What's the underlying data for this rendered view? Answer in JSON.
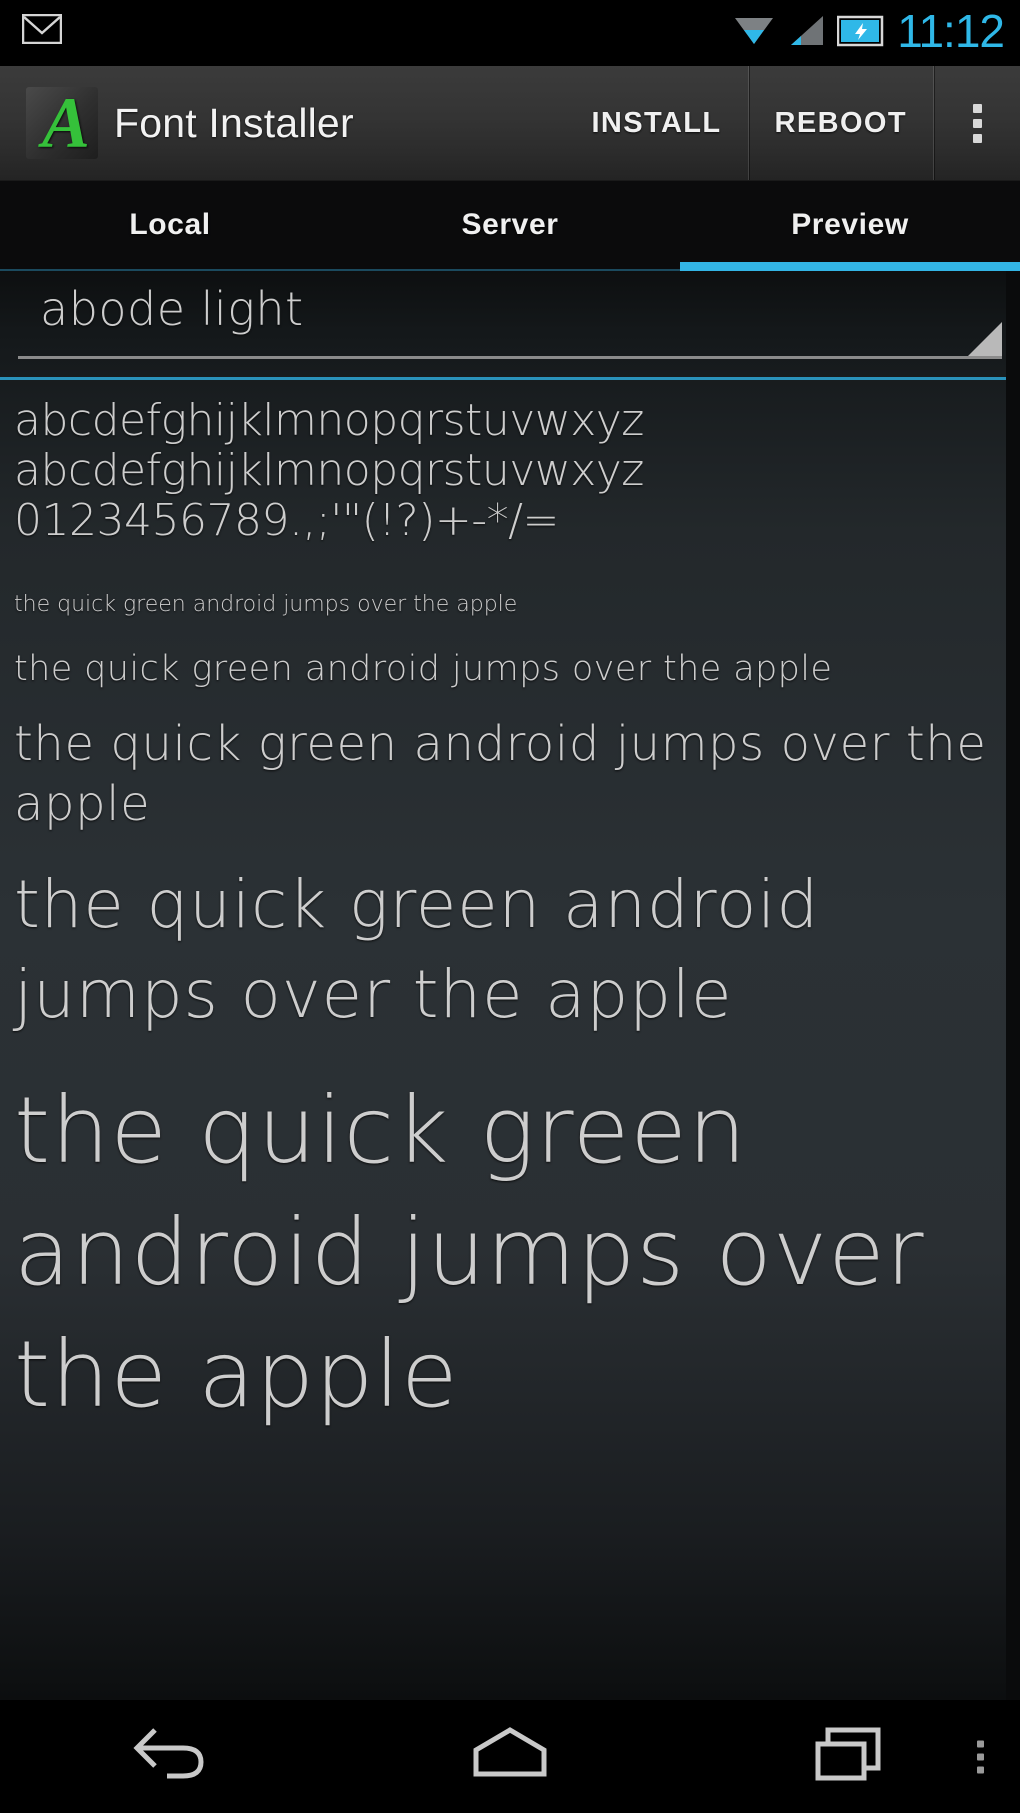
{
  "statusbar": {
    "time": "11:12",
    "icons": [
      "gmail-icon",
      "wifi-icon",
      "signal-icon",
      "battery-icon"
    ]
  },
  "actionbar": {
    "logo": "font-installer-logo",
    "title": "Font Installer",
    "install_label": "INSTALL",
    "reboot_label": "REBOOT",
    "overflow_label": "overflow-menu"
  },
  "tabs": [
    {
      "label": "Local",
      "active": false
    },
    {
      "label": "Server",
      "active": false
    },
    {
      "label": "Preview",
      "active": true
    }
  ],
  "spinner": {
    "selected": "abode light",
    "caret": "dropdown-caret"
  },
  "preview": {
    "alphabet_lower": "abcdefghijklmnopqrstuvwxyz",
    "alphabet_upper": "abcdefghijklmnopqrstuvwxyz",
    "numbers": "0123456789.,;'\"(!?)+-*/=",
    "pangram": "the quick green android jumps over the apple"
  },
  "navbar": {
    "back": "back-icon",
    "home": "home-icon",
    "recents": "recents-icon",
    "menu": "menu-dots-icon"
  },
  "colors": {
    "accent": "#33b5e5",
    "clock": "#2fb8e8",
    "logo_green": "#35c13a",
    "text": "#cdcdcd"
  }
}
